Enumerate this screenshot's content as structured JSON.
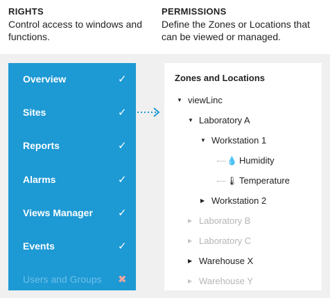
{
  "rights": {
    "title": "RIGHTS",
    "description": "Control access to windows and functions.",
    "items": [
      {
        "label": "Overview",
        "mark": "✓",
        "enabled": true
      },
      {
        "label": "Sites",
        "mark": "✓",
        "enabled": true
      },
      {
        "label": "Reports",
        "mark": "✓",
        "enabled": true
      },
      {
        "label": "Alarms",
        "mark": "✓",
        "enabled": true
      },
      {
        "label": "Views Manager",
        "mark": "✓",
        "enabled": true
      },
      {
        "label": "Events",
        "mark": "✓",
        "enabled": true
      },
      {
        "label": "Users and Groups",
        "mark": "✖",
        "enabled": false
      }
    ]
  },
  "permissions": {
    "title": "PERMISSIONS",
    "description": "Define the Zones or Locations that can be viewed or managed.",
    "panel_title": "Zones and Locations",
    "tree": [
      {
        "label": "viewLinc"
      },
      {
        "label": "Laboratory A"
      },
      {
        "label": "Workstation 1"
      },
      {
        "label": "Humidity",
        "icon": "droplet-icon"
      },
      {
        "label": "Temperature",
        "icon": "thermometer-icon"
      },
      {
        "label": "Workstation 2"
      },
      {
        "label": "Laboratory B"
      },
      {
        "label": "Laboratory C"
      },
      {
        "label": "Warehouse X"
      },
      {
        "label": "Warehouse Y"
      }
    ]
  },
  "colors": {
    "rights_bg": "#1d99d4",
    "page_band": "#f0f0f0",
    "connector": "#1d99d4",
    "disabled_mark": "#f0a6a0"
  }
}
